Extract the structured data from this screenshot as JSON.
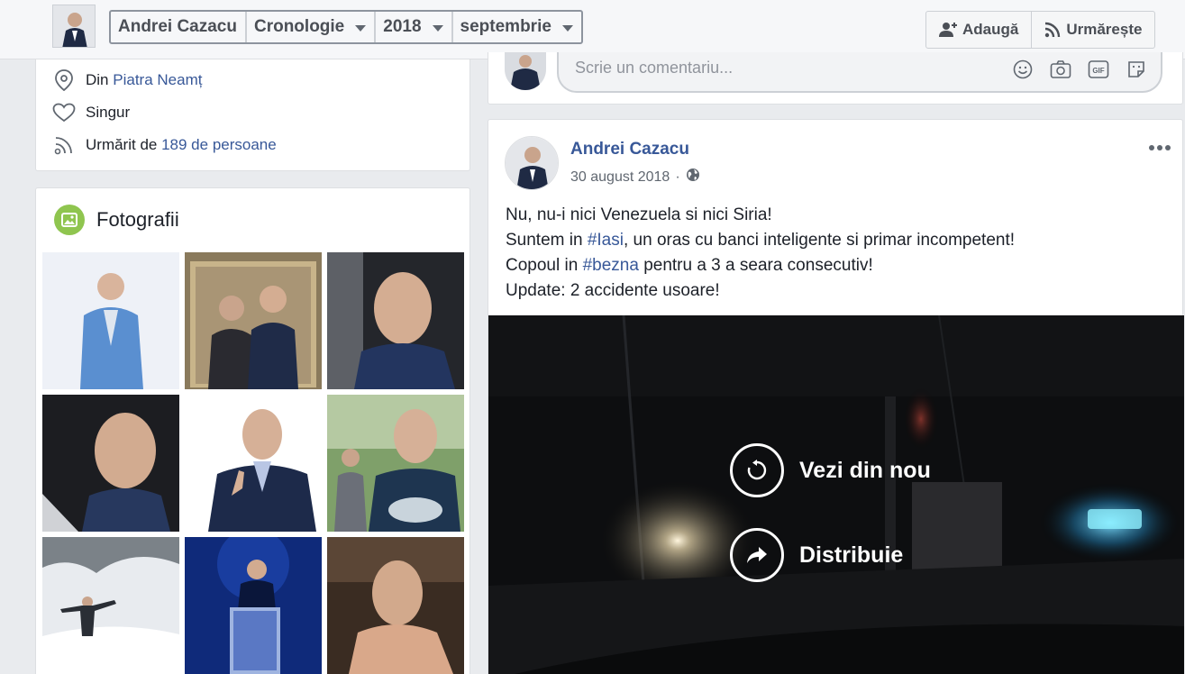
{
  "header": {
    "name": "Andrei Cazacu",
    "section": "Cronologie",
    "year": "2018",
    "month": "septembrie",
    "add_label": "Adaugă",
    "follow_label": "Urmărește"
  },
  "intro": {
    "from_prefix": "Din",
    "from_city": "Piatra Neamț",
    "relationship": "Singur",
    "followed_prefix": "Urmărit de",
    "followed_link": "189 de persoane"
  },
  "photos": {
    "title": "Fotografii"
  },
  "comment_box": {
    "placeholder": "Scrie un comentariu...",
    "gif_label": "GIF"
  },
  "post": {
    "author": "Andrei Cazacu",
    "date": "30 august 2018",
    "separator": "·",
    "line1": "Nu, nu-i nici Venezuela si nici Siria!",
    "line2_a": "Suntem in",
    "line2_tag": "#Iasi",
    "line2_b": ", un oras cu banci inteligente si primar incompetent!",
    "line3_a": "Copoul in",
    "line3_tag": "#bezna",
    "line3_b": "pentru a 3 a seara consecutiv!",
    "line4": "Update: 2 accidente usoare!"
  },
  "video": {
    "replay_label": "Vezi din nou",
    "share_label": "Distribuie"
  },
  "colors": {
    "link": "#385898",
    "photos_badge": "#8fc54f",
    "background": "#e9ebee"
  }
}
